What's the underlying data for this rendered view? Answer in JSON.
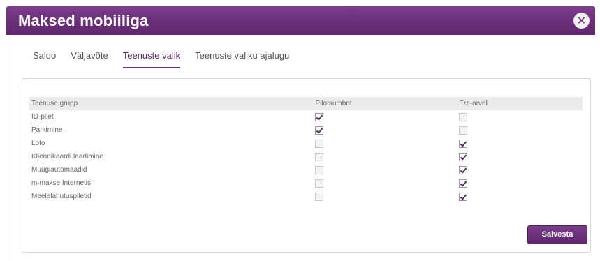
{
  "window": {
    "title": "Maksed mobiiliga",
    "close_glyph": "✕"
  },
  "tabs": [
    {
      "label": "Saldo",
      "active": false
    },
    {
      "label": "Väljavõte",
      "active": false
    },
    {
      "label": "Teenuste valik",
      "active": true
    },
    {
      "label": "Teenuste valiku ajalugu",
      "active": false
    }
  ],
  "table": {
    "headers": [
      "Teenuse grupp",
      "Pilotsumbnt",
      "Era-arvel"
    ],
    "rows": [
      {
        "name": "ID-pilet",
        "col_a": true,
        "col_b": false
      },
      {
        "name": "Parkimine",
        "col_a": true,
        "col_b": false
      },
      {
        "name": "Loto",
        "col_a": false,
        "col_b": true
      },
      {
        "name": "Kliendikaardi laadimine",
        "col_a": false,
        "col_b": true
      },
      {
        "name": "Müügiautomaadid",
        "col_a": false,
        "col_b": true
      },
      {
        "name": "m-makse Internetis",
        "col_a": false,
        "col_b": true
      },
      {
        "name": "Meelelahutuspiletid",
        "col_a": false,
        "col_b": true
      }
    ]
  },
  "actions": {
    "save_label": "Salvesta"
  },
  "colors": {
    "accent": "#6a2f79",
    "titlebar": "#6a2f79"
  }
}
